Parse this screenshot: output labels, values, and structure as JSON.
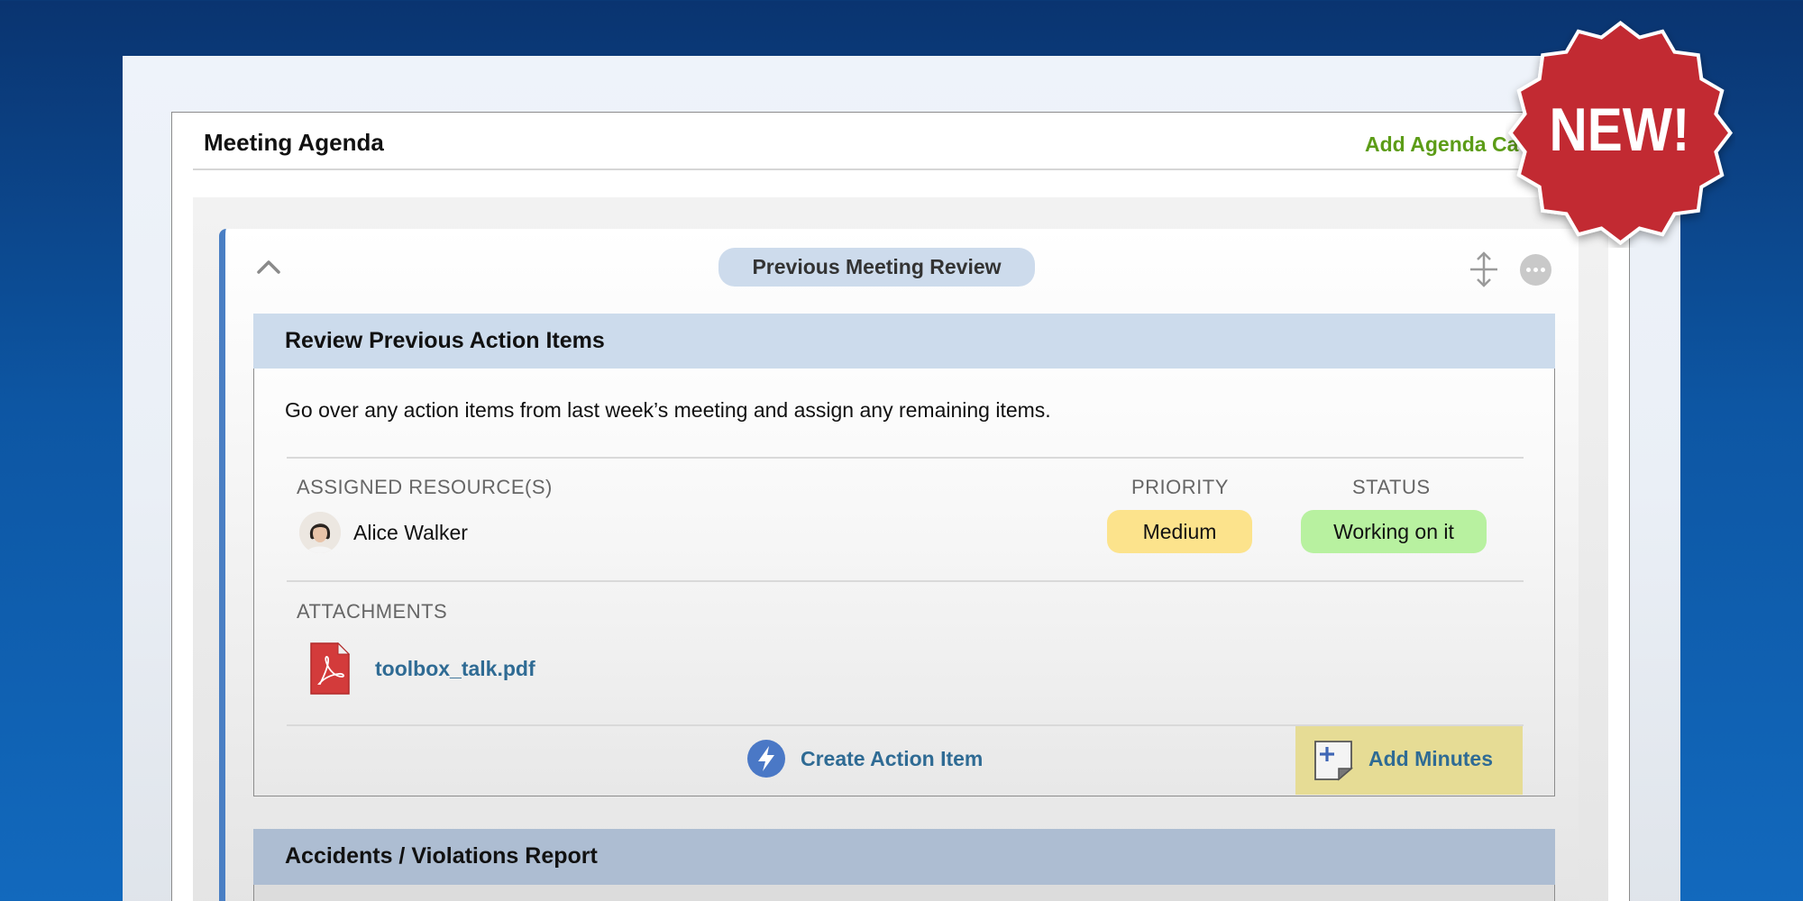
{
  "panel": {
    "title": "Meeting Agenda",
    "add_agenda_label": "Add Agenda Ca"
  },
  "category": {
    "title": "Previous Meeting Review"
  },
  "items": [
    {
      "title": "Review Previous Action Items",
      "description": "Go over any action items from last week’s meeting and assign any remaining items.",
      "assigned_label": "ASSIGNED RESOURCE(S)",
      "priority_label": "PRIORITY",
      "status_label": "STATUS",
      "resource_name": "Alice Walker",
      "priority_value": "Medium",
      "status_value": "Working on it",
      "attachments_label": "ATTACHMENTS",
      "attachment_file": "toolbox_talk.pdf",
      "create_action_label": "Create Action Item",
      "add_minutes_label": "Add Minutes"
    },
    {
      "title": "Accidents / Violations Report"
    }
  ],
  "badge": {
    "text": "NEW!"
  },
  "colors": {
    "background": "#0d56a3",
    "accent_green": "#5c9c17",
    "link_blue": "#2f6b94",
    "priority_medium": "#fce38c",
    "status_working": "#b8f1a0",
    "minutes_bg": "#e6dc95",
    "badge_red": "#c22a30"
  },
  "icons": [
    "chevron-up-icon",
    "move-icon",
    "more-icon",
    "pdf-icon",
    "lightning-bolt-icon",
    "add-note-icon"
  ]
}
